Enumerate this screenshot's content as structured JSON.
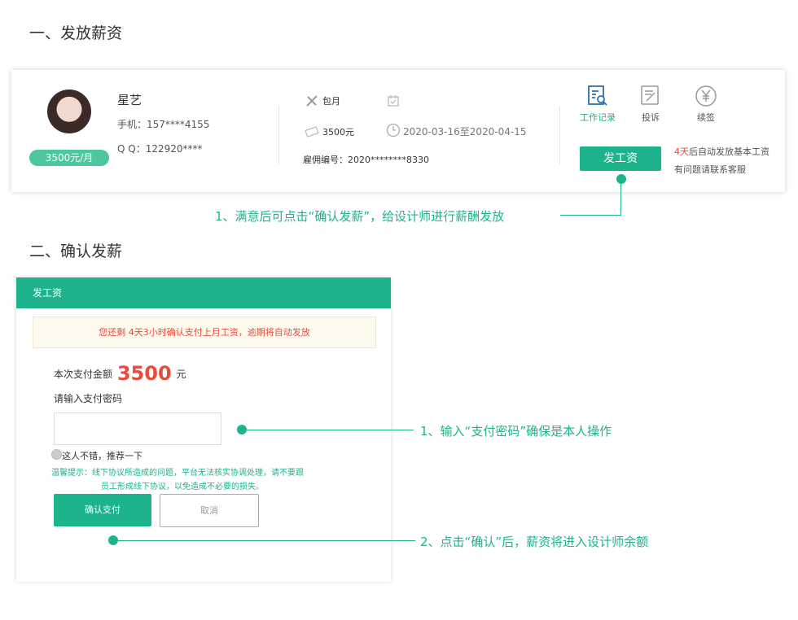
{
  "section1": {
    "title": "一、发放薪资"
  },
  "designer": {
    "name": "星艺",
    "phone": "手机：157****4155",
    "qq": "Q Q：122920****",
    "salary_badge": "3500元/月"
  },
  "contract": {
    "type": "包月",
    "amount": "3500元",
    "period": "2020-03-16至2020-04-15",
    "employ_no": "雇佣编号：2020********8330"
  },
  "actions": {
    "work_record": "工作记录",
    "complain": "投诉",
    "renew": "续签",
    "pay_button": "发工资",
    "auto_days": "4天",
    "auto_text": "后自动发放基本工资",
    "contact_text": "有问题请联系客服"
  },
  "annotations": {
    "a1": "1、满意后可点击“确认发薪”，给设计师进行薪酬发放",
    "a2": "1、输入“支付密码”确保是本人操作",
    "a3": "2、点击“确认”后，薪资将进入设计师余额"
  },
  "section2": {
    "title": "二、确认发薪"
  },
  "dialog": {
    "header": "发工资",
    "notice": "您还剩 4天3小时确认支付上月工资，逾期将自动发放",
    "amount_label": "本次支付金额",
    "amount_value": "3500",
    "amount_unit": "元",
    "password_label": "请输入支付密码",
    "recommend_label": "这人不错，推荐一下",
    "tip_line1": "温馨提示：线下协议所造成的问题，平台无法核实协调处理，请不要跟",
    "tip_line2": "员工形成线下协议，以免造成不必要的损失。",
    "confirm_button": "确认支付",
    "cancel_button": "取消"
  },
  "colors": {
    "accent": "#1cb38d",
    "warning": "#e74c3c",
    "badge": "#4cc7a0"
  }
}
